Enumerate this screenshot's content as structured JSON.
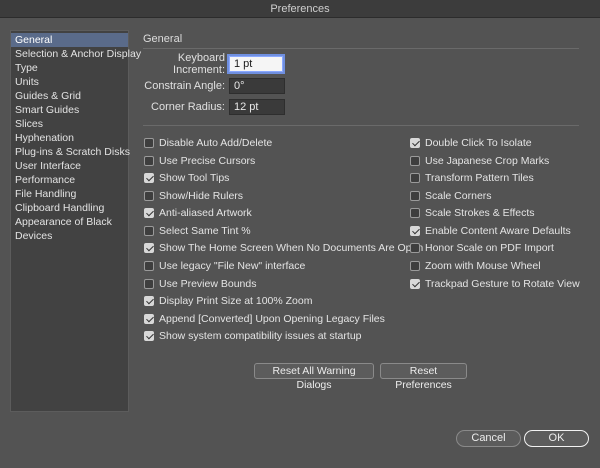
{
  "window": {
    "title": "Preferences"
  },
  "sidebar": {
    "items": [
      {
        "label": "General",
        "selected": true
      },
      {
        "label": "Selection & Anchor Display"
      },
      {
        "label": "Type"
      },
      {
        "label": "Units"
      },
      {
        "label": "Guides & Grid"
      },
      {
        "label": "Smart Guides"
      },
      {
        "label": "Slices"
      },
      {
        "label": "Hyphenation"
      },
      {
        "label": "Plug-ins & Scratch Disks"
      },
      {
        "label": "User Interface"
      },
      {
        "label": "Performance"
      },
      {
        "label": "File Handling"
      },
      {
        "label": "Clipboard Handling"
      },
      {
        "label": "Appearance of Black"
      },
      {
        "label": "Devices"
      }
    ]
  },
  "general": {
    "section_title": "General",
    "keyboard_increment": {
      "label": "Keyboard Increment:",
      "value": "1 pt"
    },
    "constrain_angle": {
      "label": "Constrain Angle:",
      "value": "0°"
    },
    "corner_radius": {
      "label": "Corner Radius:",
      "value": "12 pt"
    },
    "left_options": [
      {
        "label": "Disable Auto Add/Delete",
        "checked": false
      },
      {
        "label": "Use Precise Cursors",
        "checked": false
      },
      {
        "label": "Show Tool Tips",
        "checked": true
      },
      {
        "label": "Show/Hide Rulers",
        "checked": false
      },
      {
        "label": "Anti-aliased Artwork",
        "checked": true
      },
      {
        "label": "Select Same Tint %",
        "checked": false
      },
      {
        "label": "Show The Home Screen When No Documents Are Open",
        "checked": true
      },
      {
        "label": "Use legacy \"File New\" interface",
        "checked": false
      },
      {
        "label": "Use Preview Bounds",
        "checked": false
      },
      {
        "label": "Display Print Size at 100% Zoom",
        "checked": true
      },
      {
        "label": "Append [Converted] Upon Opening Legacy Files",
        "checked": true
      },
      {
        "label": "Show system compatibility issues at startup",
        "checked": true
      }
    ],
    "right_options": [
      {
        "label": "Double Click To Isolate",
        "checked": true
      },
      {
        "label": "Use Japanese Crop Marks",
        "checked": false
      },
      {
        "label": "Transform Pattern Tiles",
        "checked": false
      },
      {
        "label": "Scale Corners",
        "checked": false
      },
      {
        "label": "Scale Strokes & Effects",
        "checked": false
      },
      {
        "label": "Enable Content Aware Defaults",
        "checked": true
      },
      {
        "label": "Honor Scale on PDF Import",
        "checked": false
      },
      {
        "label": "Zoom with Mouse Wheel",
        "checked": false
      },
      {
        "label": "Trackpad Gesture to Rotate View",
        "checked": true
      }
    ],
    "reset_warnings_label": "Reset All Warning Dialogs",
    "reset_prefs_label": "Reset Preferences"
  },
  "footer": {
    "cancel_label": "Cancel",
    "ok_label": "OK"
  }
}
